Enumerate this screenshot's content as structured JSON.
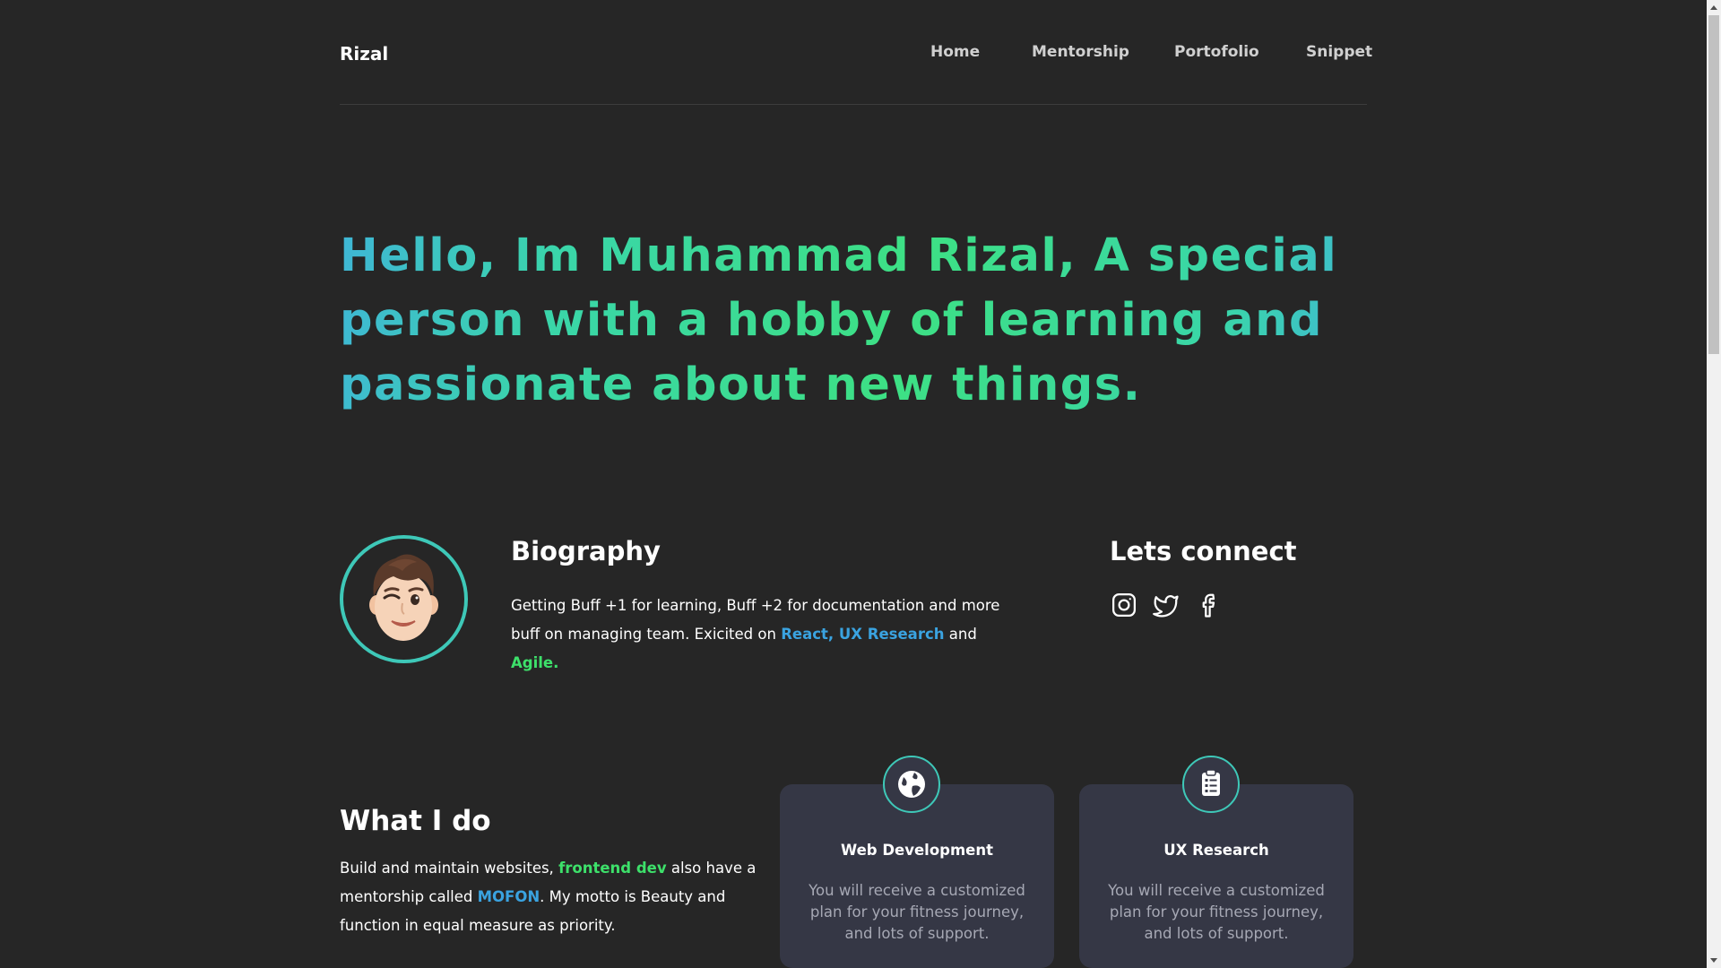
{
  "header": {
    "logo": "Rizal",
    "nav": [
      "Home",
      "Mentorship",
      "Portofolio",
      "Snippet"
    ]
  },
  "hero": {
    "headline": "Hello, Im Muhammad Rizal, A special person with a hobby of learning and passionate about new things."
  },
  "biography": {
    "title": "Biography",
    "text_1": "Getting Buff +1 for learning, Buff +2 for documentation and more buff on managing team. Exicited on ",
    "highlight_1": "React, UX Research",
    "text_2": " and ",
    "highlight_2": "Agile."
  },
  "connect": {
    "title": "Lets connect",
    "icons": [
      "instagram-icon",
      "twitter-icon",
      "facebook-icon"
    ]
  },
  "what_i_do": {
    "title": "What I do",
    "text_1": "Build and maintain websites, ",
    "highlight_1": "frontend dev",
    "text_2": " also have a mentorship called ",
    "highlight_2": "MOFON",
    "text_3": ". My motto is Beauty and function in equal measure as priority."
  },
  "cards": [
    {
      "title": "Web Development",
      "icon": "globe-icon",
      "description": "You will receive a customized plan for your fitness journey, and lots of support."
    },
    {
      "title": "UX Research",
      "icon": "clipboard-icon",
      "description": "You will receive a customized plan for your fitness journey, and lots of support."
    }
  ],
  "colors": {
    "background": "#262626",
    "card": "#353745",
    "accent_green": "#3de06a",
    "accent_blue": "#3aa3e0",
    "accent_teal": "#3ec8b8"
  }
}
